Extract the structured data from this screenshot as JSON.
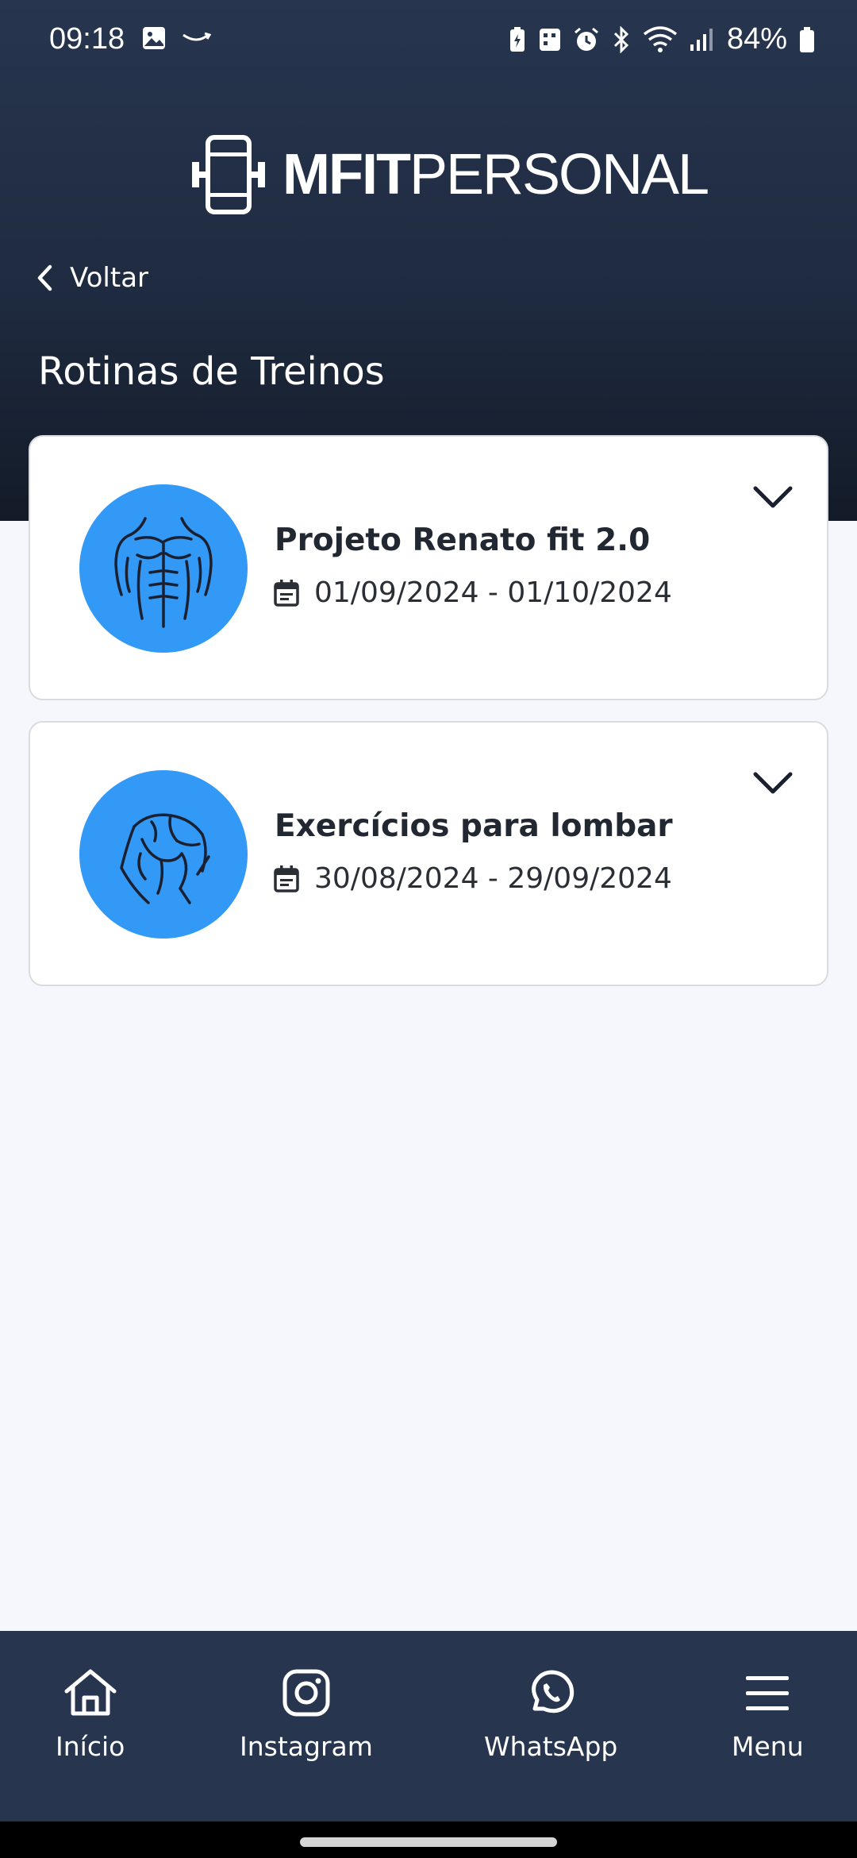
{
  "status_bar": {
    "time": "09:18",
    "battery": "84%",
    "icons": [
      "image-icon",
      "amazon-icon",
      "battery-saver-icon",
      "building-icon",
      "alarm-icon",
      "bluetooth-icon",
      "wifi-icon",
      "signal-icon",
      "battery-icon"
    ]
  },
  "header": {
    "logo_bold": "MFIT",
    "logo_light": "PERSONAL",
    "back_label": "Voltar",
    "title": "Rotinas de Treinos"
  },
  "routines": [
    {
      "title": "Projeto Renato fit 2.0",
      "dates": "01/09/2024 - 01/10/2024",
      "icon": "abs-muscle-icon"
    },
    {
      "title": "Exercícios para lombar",
      "dates": "30/08/2024 - 29/09/2024",
      "icon": "back-muscle-icon"
    }
  ],
  "bottom_nav": {
    "items": [
      {
        "label": "Início",
        "icon": "home-icon"
      },
      {
        "label": "Instagram",
        "icon": "instagram-icon"
      },
      {
        "label": "WhatsApp",
        "icon": "whatsapp-icon"
      },
      {
        "label": "Menu",
        "icon": "menu-icon"
      }
    ]
  },
  "colors": {
    "header": "#27354f",
    "accent": "#3399f7",
    "background": "#f5f7fc"
  }
}
